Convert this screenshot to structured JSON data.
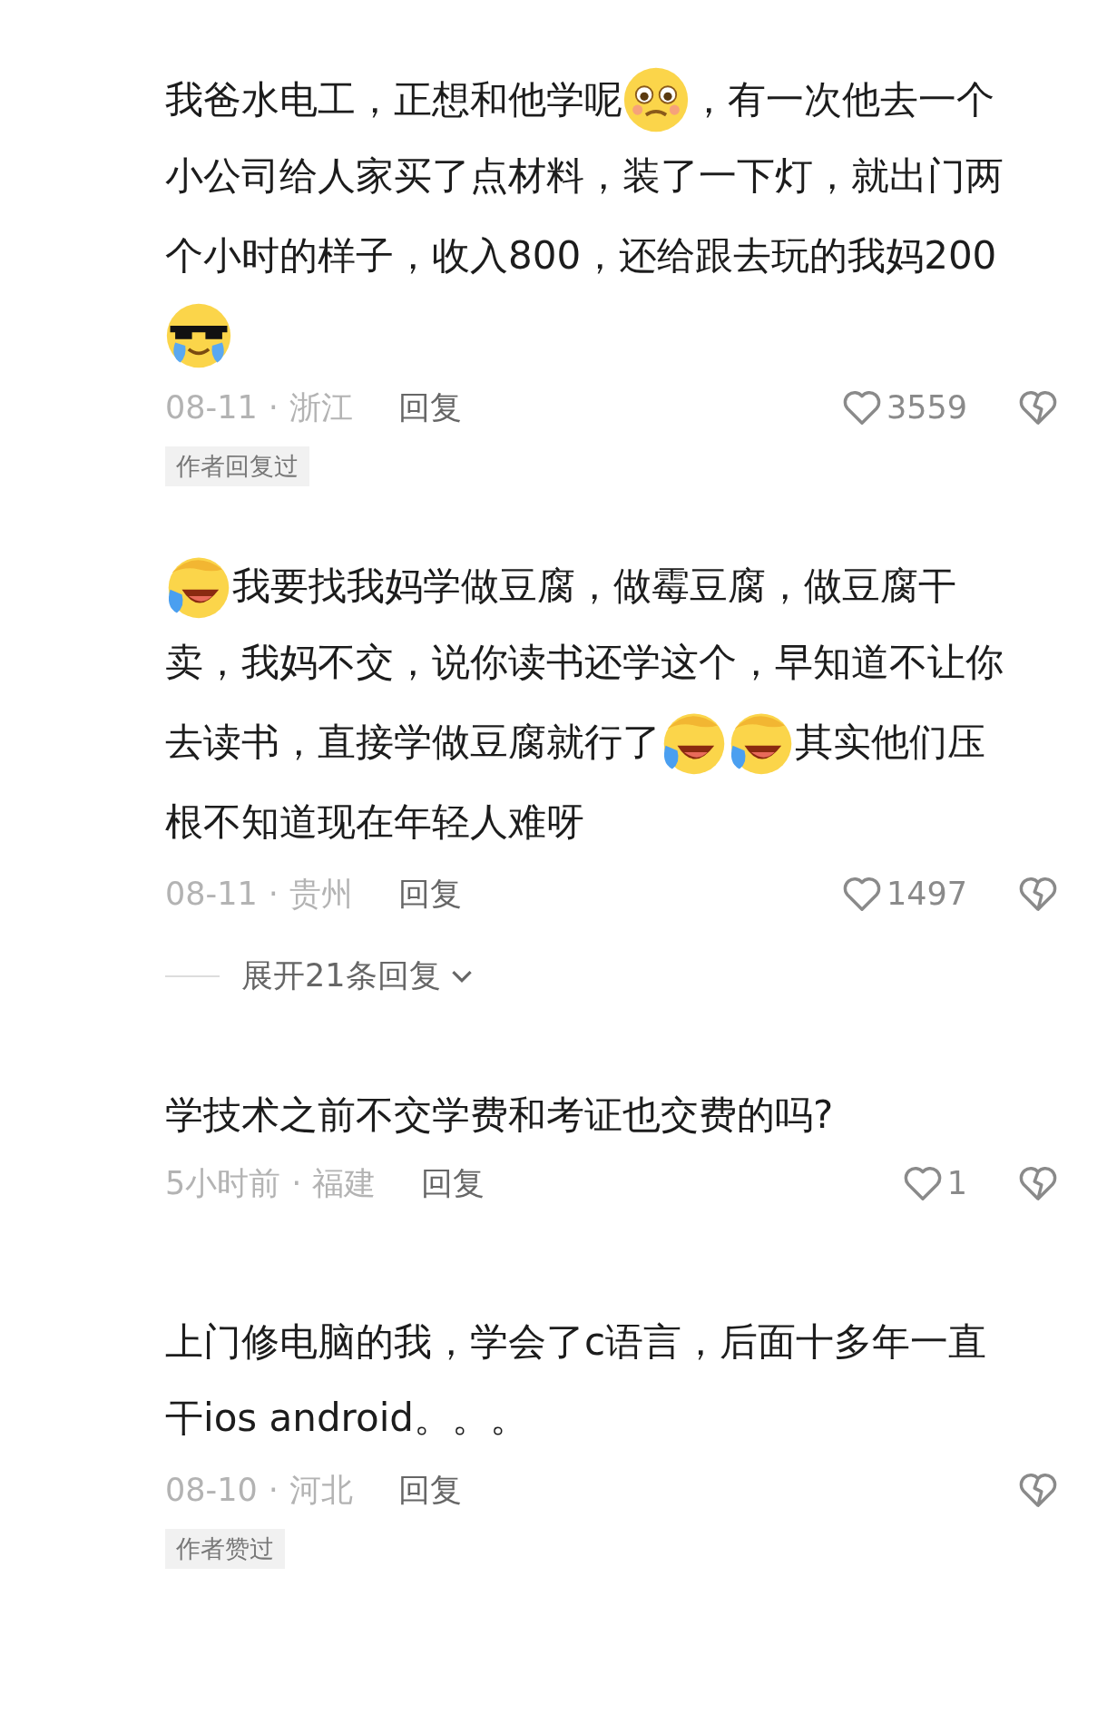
{
  "comments": [
    {
      "lines": [
        [
          {
            "kind": "text",
            "text": "我爸水电工，正想和他学呢"
          },
          {
            "kind": "pleading"
          },
          {
            "kind": "text",
            "text": "，有一次他去一个"
          }
        ],
        [
          {
            "kind": "text",
            "text": "小公司给人家买了点材料，装了一下灯，就出门两"
          }
        ],
        [
          {
            "kind": "text",
            "text": "个小时的样子，收入800，还给跟去玩的我妈200"
          }
        ],
        [
          {
            "kind": "shades-tears"
          }
        ]
      ],
      "date": "08-11",
      "separator": "·",
      "region": "浙江",
      "reply": "回复",
      "likes": "3559",
      "tag": "作者回复过"
    },
    {
      "lines": [
        [
          {
            "kind": "facepalm-laugh"
          },
          {
            "kind": "text",
            "text": "我要找我妈学做豆腐，做霉豆腐，做豆腐干"
          }
        ],
        [
          {
            "kind": "text",
            "text": "卖，我妈不交，说你读书还学这个，早知道不让你"
          }
        ],
        [
          {
            "kind": "text",
            "text": "去读书，直接学做豆腐就行了"
          },
          {
            "kind": "facepalm-laugh"
          },
          {
            "kind": "facepalm-laugh"
          },
          {
            "kind": "text",
            "text": "其实他们压"
          }
        ],
        [
          {
            "kind": "text",
            "text": "根不知道现在年轻人难呀"
          }
        ]
      ],
      "date": "08-11",
      "separator": "·",
      "region": "贵州",
      "reply": "回复",
      "likes": "1497",
      "expand": "展开21条回复"
    },
    {
      "lines": [
        [
          {
            "kind": "text",
            "text": "学技术之前不交学费和考证也交费的吗?"
          }
        ]
      ],
      "date": "5小时前",
      "separator": "·",
      "region": "福建",
      "reply": "回复",
      "likes": "1"
    },
    {
      "lines": [
        [
          {
            "kind": "text",
            "text": "上门修电脑的我，学会了c语言，后面十多年一直"
          }
        ],
        [
          {
            "kind": "text",
            "text": "干ios android。。。"
          }
        ]
      ],
      "date": "08-10",
      "separator": "·",
      "region": "河北",
      "reply": "回复",
      "tag": "作者赞过"
    }
  ]
}
